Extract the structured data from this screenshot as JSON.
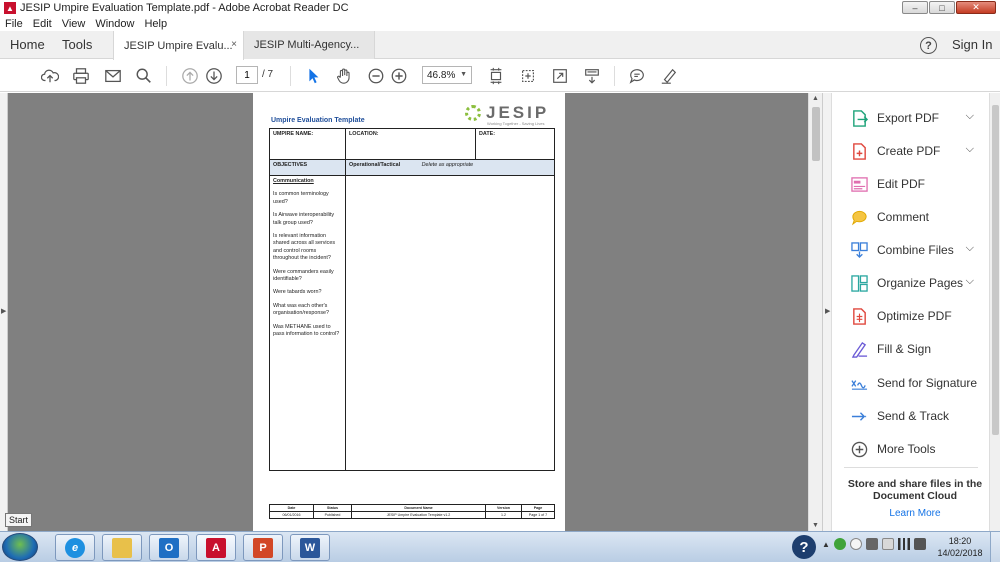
{
  "window": {
    "title": "JESIP Umpire Evaluation Template.pdf - Adobe Acrobat Reader DC",
    "min": "–",
    "max": "□",
    "close": "✕"
  },
  "menu": [
    "File",
    "Edit",
    "View",
    "Window",
    "Help"
  ],
  "nav": {
    "home": "Home",
    "tools": "Tools"
  },
  "tabs": [
    {
      "label": "JESIP Umpire Evalu...",
      "close": "×"
    },
    {
      "label": "JESIP Multi-Agency..."
    }
  ],
  "header_right": {
    "help": "?",
    "signin": "Sign In"
  },
  "toolbar": {
    "page_current": "1",
    "page_total": "/ 7",
    "zoom": "46.8%"
  },
  "document": {
    "title": "Umpire Evaluation Template",
    "logo_text": "JESIP",
    "logo_tagline": "Working Together - Saving Lives",
    "fields": {
      "umpire": "UMPIRE NAME:",
      "location": "LOCATION:",
      "date": "DATE:"
    },
    "objectives_header": "OBJECTIVES",
    "operational_header": "Operational/Tactical",
    "delete_note": "Delete as appropriate",
    "section": "Communication",
    "questions": [
      "Is common terminology used?",
      "Is Airwave interoperability talk group used?",
      "Is relevant information shared across all services and control rooms throughout the incident?",
      "Were commanders easily identifiable?",
      "Were tabards worn?",
      "What was each other's organisation/response?",
      "Was METHANE used to pass information to control?"
    ],
    "footer": {
      "headers": [
        "Date",
        "Status",
        "Document Name",
        "Version",
        "Page"
      ],
      "values": [
        "06/01/2016",
        "Published",
        "JESIP Umpire Evaluation Template v1.2",
        "1.2",
        "Page 1 of 7"
      ]
    }
  },
  "right_panel": {
    "tools": [
      {
        "label": "Export PDF",
        "chevron": true,
        "color": "#1fa37a"
      },
      {
        "label": "Create PDF",
        "chevron": true,
        "color": "#e0483e"
      },
      {
        "label": "Edit PDF",
        "chevron": false,
        "color": "#e06fb0"
      },
      {
        "label": "Comment",
        "chevron": false,
        "color": "#f0b400"
      },
      {
        "label": "Combine Files",
        "chevron": true,
        "color": "#3b7fd9"
      },
      {
        "label": "Organize Pages",
        "chevron": true,
        "color": "#2aa7a0"
      },
      {
        "label": "Optimize PDF",
        "chevron": false,
        "color": "#e0483e"
      },
      {
        "label": "Fill & Sign",
        "chevron": false,
        "color": "#6b5bd6"
      },
      {
        "label": "Send for Signature",
        "chevron": false,
        "color": "#3b7fd9"
      },
      {
        "label": "Send & Track",
        "chevron": false,
        "color": "#3b7fd9"
      },
      {
        "label": "More Tools",
        "chevron": false,
        "color": "#555555"
      }
    ],
    "cloud_text": "Store and share files in the Document Cloud",
    "learn_more": "Learn More"
  },
  "taskbar": {
    "start_tooltip": "Start",
    "help": "?",
    "time": "18:20",
    "date": "14/02/2018"
  },
  "accent": "#1473e6"
}
